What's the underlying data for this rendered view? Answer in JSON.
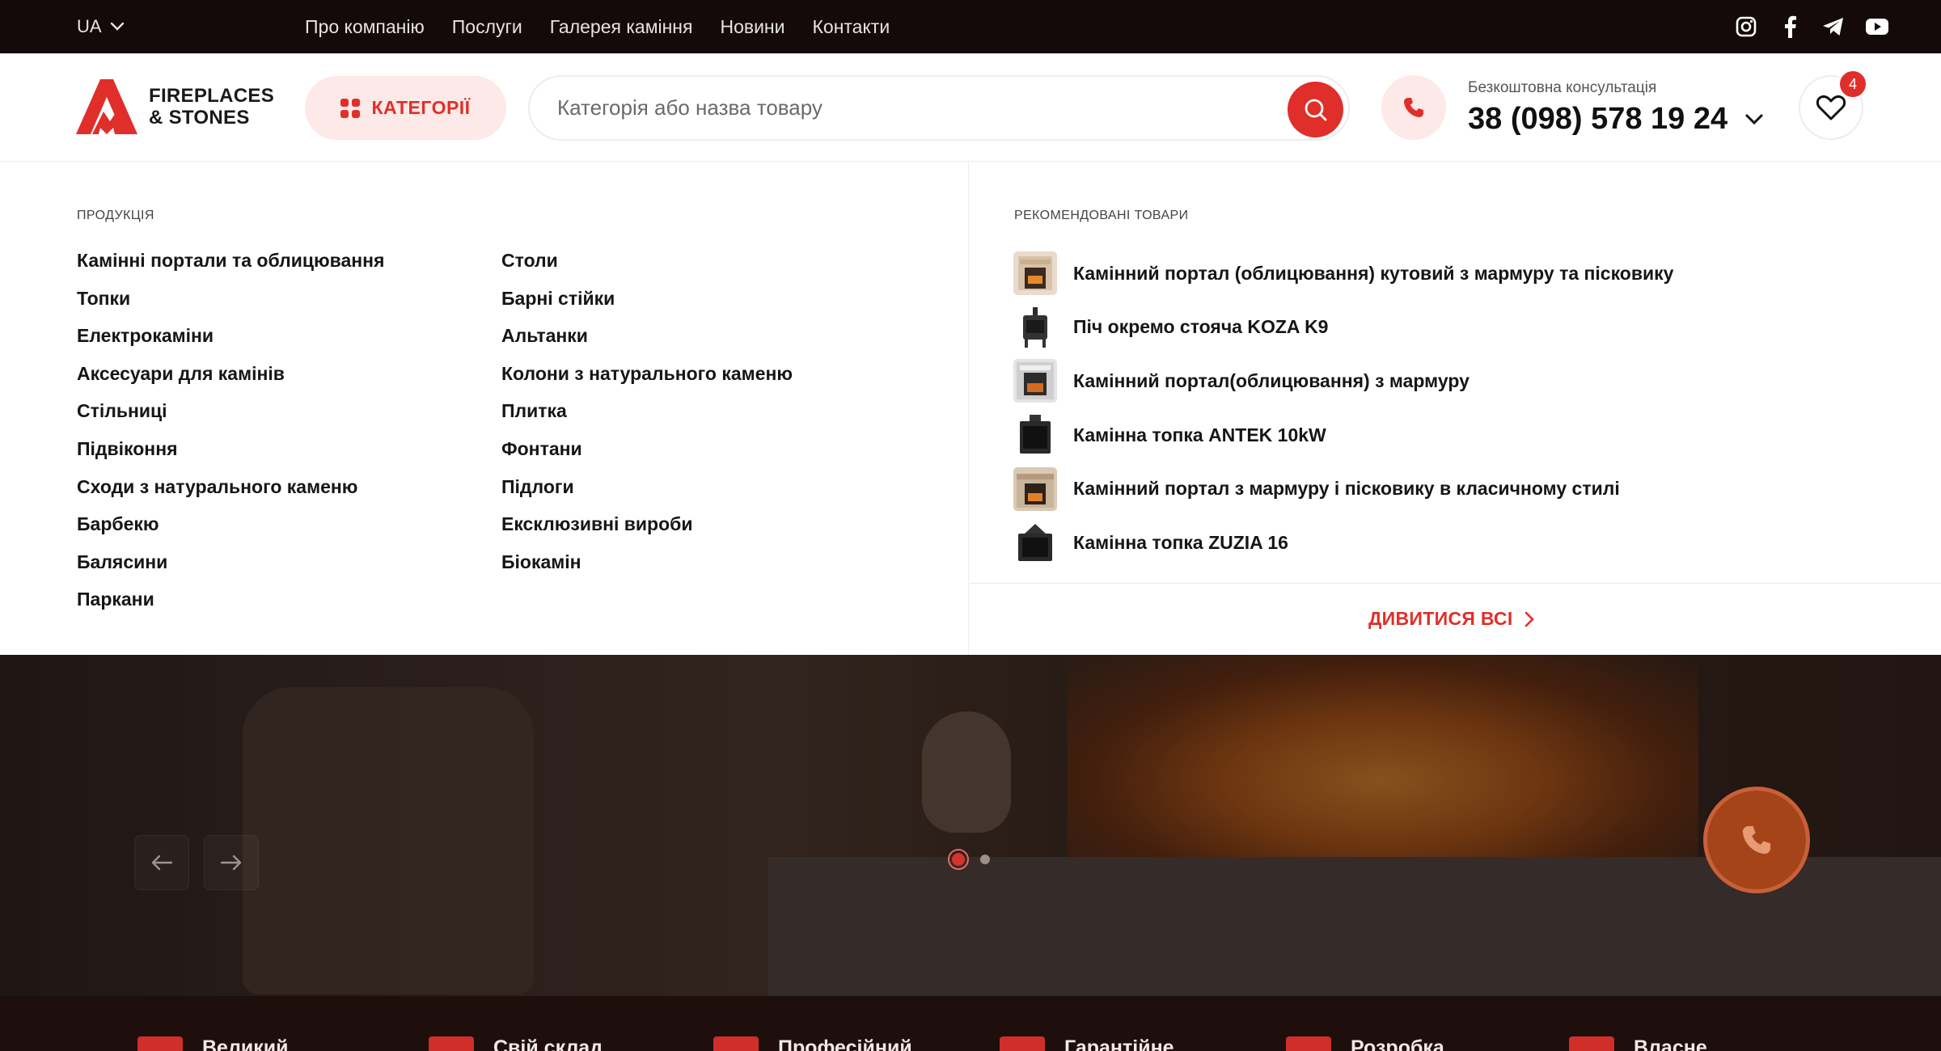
{
  "topbar": {
    "lang": "UA",
    "nav": [
      "Про компанію",
      "Послуги",
      "Галерея каміння",
      "Новини",
      "Контакти"
    ],
    "socials": [
      "instagram-icon",
      "facebook-icon",
      "telegram-icon",
      "youtube-icon"
    ]
  },
  "header": {
    "logo_line1": "FIREPLACES",
    "logo_line2": "& STONES",
    "categories_label": "КАТЕГОРІЇ",
    "search_placeholder": "Категорія або назва товару",
    "consult_label": "Безкоштовна консультація",
    "phone": "38 (098) 578 19 24",
    "favorites_count": "4"
  },
  "menu": {
    "products_title": "ПРОДУКЦІЯ",
    "col1": [
      "Камінні портали та облицювання",
      "Топки",
      "Електрокаміни",
      "Аксесуари для камінів",
      "Стільниці",
      "Підвіконня",
      "Сходи з натурального каменю",
      "Барбекю",
      "Балясини",
      "Паркани"
    ],
    "col2": [
      "Столи",
      "Барні стійки",
      "Альтанки",
      "Колони з натурального каменю",
      "Плитка",
      "Фонтани",
      "Підлоги",
      "Ексклюзивні вироби",
      "Біокамін"
    ],
    "recommended_title": "РЕКОМЕНДОВАНІ ТОВАРИ",
    "recommended": [
      "Камінний портал (облицювання) кутовий з мармуру та пісковику",
      "Піч окремо стояча KOZA K9",
      "Камінний портал(облицювання) з мармуру",
      "Камінна топка ANTEK 10kW",
      "Камінний портал з мармуру і пісковику в класичному стилі",
      "Камінна топка ZUZIA 16"
    ],
    "view_all": "ДИВИТИСЯ ВСІ"
  },
  "hero": {
    "slides_total": 2,
    "active_slide": 1
  },
  "features": [
    "Великий",
    "Свій склад",
    "Професійний",
    "Гарантійне",
    "Розробка",
    "Власне"
  ],
  "colors": {
    "accent": "#e02f2a",
    "topbar_bg": "#140a0a",
    "accent_soft": "#fde9e7"
  }
}
